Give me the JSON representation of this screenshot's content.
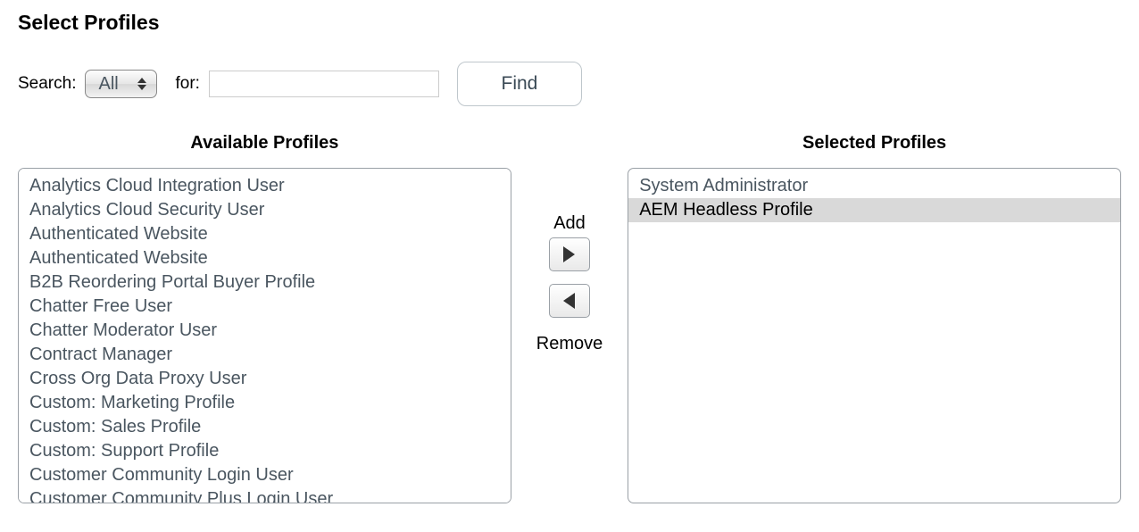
{
  "title": "Select Profiles",
  "search": {
    "label": "Search:",
    "selected_option": "All",
    "for_label": "for:",
    "input_value": "",
    "find_label": "Find"
  },
  "available": {
    "header": "Available Profiles",
    "items": [
      "Analytics Cloud Integration User",
      "Analytics Cloud Security User",
      "Authenticated Website",
      "Authenticated Website",
      "B2B Reordering Portal Buyer Profile",
      "Chatter Free User",
      "Chatter Moderator User",
      "Contract Manager",
      "Cross Org Data Proxy User",
      "Custom: Marketing Profile",
      "Custom: Sales Profile",
      "Custom: Support Profile",
      "Customer Community Login User",
      "Customer Community Plus Login User"
    ]
  },
  "selected": {
    "header": "Selected Profiles",
    "items": [
      {
        "label": "System Administrator",
        "highlighted": false
      },
      {
        "label": "AEM Headless Profile",
        "highlighted": true
      }
    ]
  },
  "controls": {
    "add_label": "Add",
    "remove_label": "Remove"
  }
}
